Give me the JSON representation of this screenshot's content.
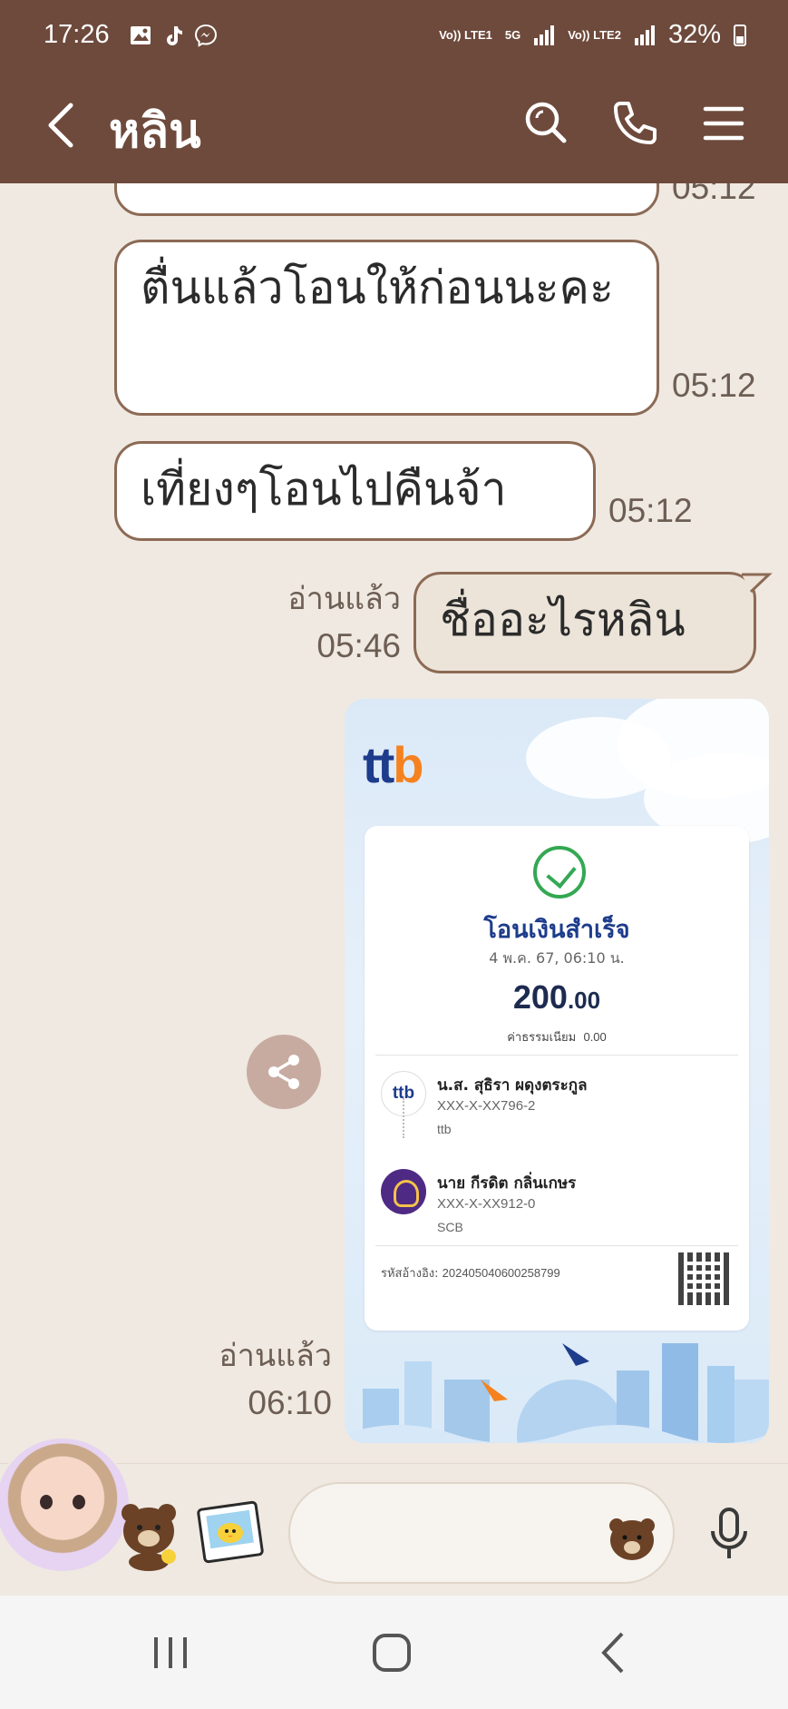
{
  "status_bar": {
    "time": "17:26",
    "net1": "Vo)) LTE1",
    "net_5g": "5G",
    "net2": "Vo)) LTE2",
    "battery": "32%"
  },
  "header": {
    "title": "หลิน",
    "back_icon": "chevron-left-icon",
    "search_icon": "search-icon",
    "call_icon": "phone-icon",
    "menu_icon": "menu-icon",
    "bg_color": "#6e4a3c"
  },
  "messages": [
    {
      "text": "",
      "time": "05:12"
    },
    {
      "text": "ตื่นแล้วโอนให้ก่อนนะคะ",
      "time": "05:12"
    },
    {
      "text": "เที่ยงๆโอนไปคืนจ้า",
      "time": "05:12"
    },
    {
      "text": "ชื่ออะไรหลิน",
      "read": "อ่านแล้ว",
      "time": "05:46"
    }
  ],
  "receipt": {
    "bank_logo": "ttb",
    "title": "โอนเงินสำเร็จ",
    "date": "4 พ.ค. 67, 06:10 น.",
    "amount_int": "200",
    "amount_dec": ".00",
    "fee_label": "ค่าธรรมเนียม",
    "fee_value": "0.00",
    "sender": {
      "name": "น.ส. สุธิรา ผดุงตระกูล",
      "account": "XXX-X-XX796-2",
      "bank": "ttb"
    },
    "receiver": {
      "name": "นาย กีรดิต กลิ่นเกษร",
      "account": "XXX-X-XX912-0",
      "bank": "SCB"
    },
    "ref_label": "รหัสอ้างอิง:",
    "ref_value": "2024050406002587​99",
    "read": "อ่านแล้ว",
    "time": "06:10"
  },
  "input": {
    "placeholder": ""
  }
}
